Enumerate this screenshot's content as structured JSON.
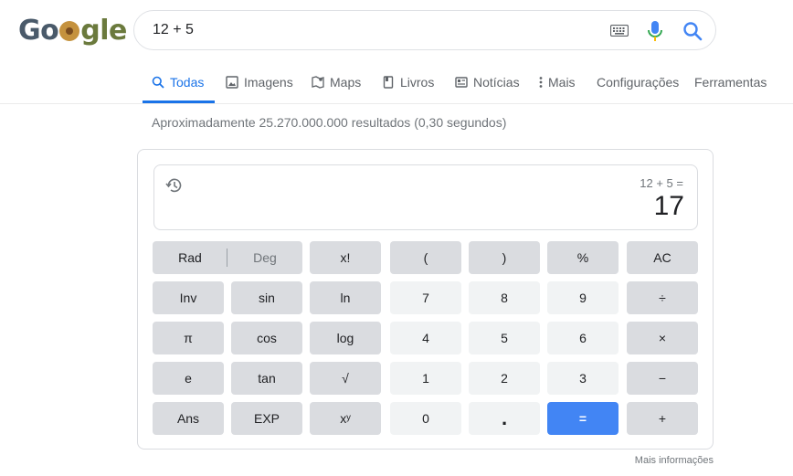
{
  "logo": {
    "parts": [
      "G",
      "o",
      "o",
      "g",
      "l",
      "e"
    ]
  },
  "search": {
    "query": "12 + 5"
  },
  "tabs": [
    {
      "label": "Todas",
      "icon": "search-icon",
      "active": true
    },
    {
      "label": "Imagens",
      "icon": "image-icon"
    },
    {
      "label": "Maps",
      "icon": "map-icon"
    },
    {
      "label": "Livros",
      "icon": "book-icon"
    },
    {
      "label": "Notícias",
      "icon": "news-icon"
    },
    {
      "label": "Mais",
      "icon": "more-vert-icon"
    },
    {
      "label": "Configurações"
    },
    {
      "label": "Ferramentas"
    }
  ],
  "results_stats": "Aproximadamente 25.270.000.000 resultados (0,30 segundos)",
  "calculator": {
    "expression": "12 + 5 =",
    "result": "17",
    "rad_label": "Rad",
    "deg_label": "Deg",
    "keys": {
      "fact": "x!",
      "lparen": "(",
      "rparen": ")",
      "percent": "%",
      "ac": "AC",
      "inv": "Inv",
      "sin": "sin",
      "ln": "ln",
      "k7": "7",
      "k8": "8",
      "k9": "9",
      "divide": "÷",
      "pi": "π",
      "cos": "cos",
      "log": "log",
      "k4": "4",
      "k5": "5",
      "k6": "6",
      "multiply": "×",
      "e": "e",
      "tan": "tan",
      "sqrt": "√",
      "k1": "1",
      "k2": "2",
      "k3": "3",
      "minus": "−",
      "ans": "Ans",
      "exp": "EXP",
      "pow": "xʸ",
      "k0": "0",
      "dot": ".",
      "equals": "=",
      "plus": "+"
    }
  },
  "more_info": "Mais informações"
}
